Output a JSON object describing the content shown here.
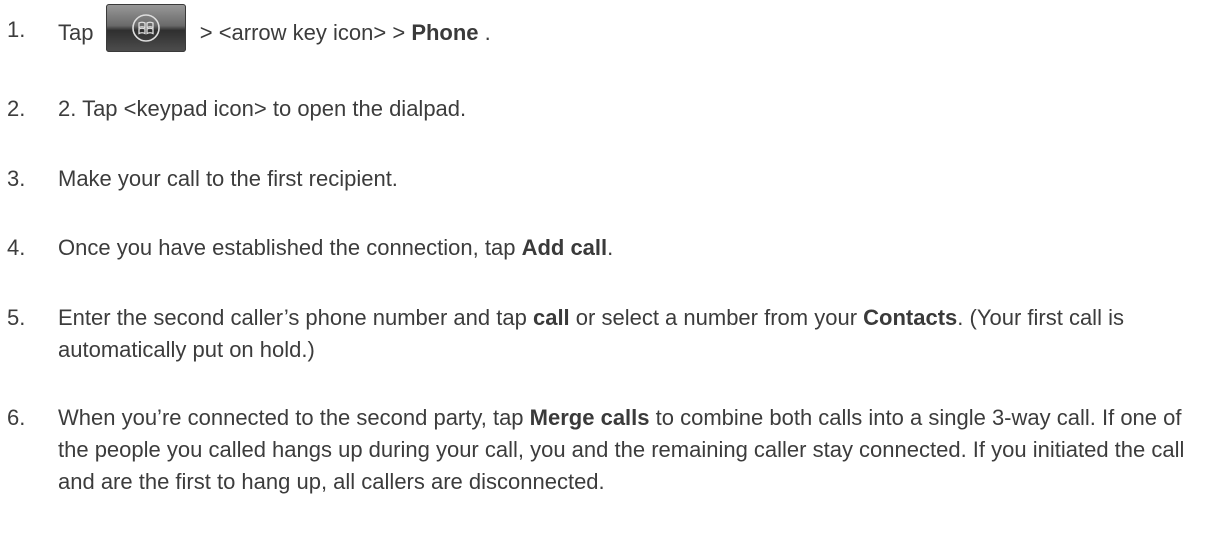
{
  "steps": [
    {
      "number": "1.",
      "tap": "Tap",
      "home_icon": "windows-start-button-icon",
      "after_icon": "> <arrow key icon> >",
      "bold": "Phone",
      "end": "."
    },
    {
      "number": "2.",
      "text": "2. Tap <keypad icon> to open the dialpad."
    },
    {
      "number": "3.",
      "text": "Make your call to the first recipient."
    },
    {
      "number": "4.",
      "before": "Once you have established the connection, tap",
      "bold": "Add call",
      "after": "."
    },
    {
      "number": "5.",
      "before": "Enter the second caller’s phone number and tap",
      "bold1": "call",
      "middle": "or select a number from your",
      "bold2": "Contacts",
      "after": ". (Your first call is automatically put on hold.)"
    },
    {
      "number": "6.",
      "before": "When you’re connected to the second party, tap",
      "bold": "Merge calls",
      "after": "to combine both calls into a single 3-way call. If one of the people you called hangs up during your call, you and the remaining caller stay connected. If you initiated the call and are the first to hang up, all callers are disconnected."
    }
  ]
}
